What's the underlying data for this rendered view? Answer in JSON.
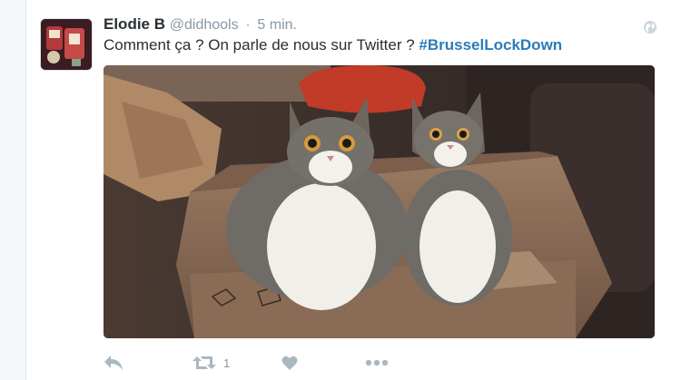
{
  "tweet": {
    "author": {
      "fullname": "Elodie B",
      "username": "@didhools"
    },
    "timestamp": "5 min.",
    "text": "Comment ça ? On parle de nous sur Twitter ? ",
    "hashtag": "#BrusselLockDown",
    "actions": {
      "retweet_count": "1"
    },
    "colors": {
      "link": "#2b7bb9",
      "secondary": "#8899a6",
      "primary_text": "#292f33"
    }
  }
}
